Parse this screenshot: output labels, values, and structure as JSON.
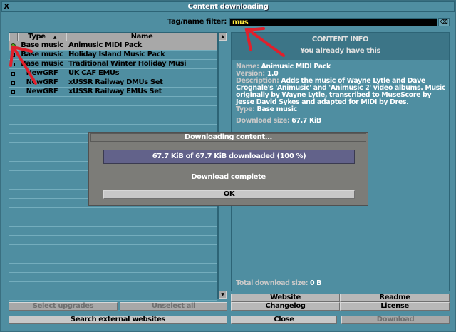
{
  "window": {
    "title": "Content downloading",
    "close_label": "X"
  },
  "filter": {
    "label": "Tag/name filter:",
    "value": "mus",
    "clear_label": "⌫"
  },
  "list": {
    "columns": {
      "type": "Type",
      "name": "Name",
      "sort_indicator": "▲"
    },
    "rows": [
      {
        "type": "Base music",
        "name": "Animusic MIDI Pack",
        "state": "installed",
        "selected": true
      },
      {
        "type": "Base music",
        "name": "Holiday Island Music Pack",
        "state": "not-installed"
      },
      {
        "type": "Base music",
        "name": "Traditional Winter Holiday Musi",
        "state": "not-installed"
      },
      {
        "type": "NewGRF",
        "name": "UK CAF EMUs",
        "state": "not-installed"
      },
      {
        "type": "NewGRF",
        "name": "xUSSR Railway DMUs Set",
        "state": "not-installed"
      },
      {
        "type": "NewGRF",
        "name": "xUSSR Railway EMUs Set",
        "state": "not-installed"
      }
    ]
  },
  "info": {
    "heading": "CONTENT INFO",
    "status": "You already have this",
    "name_key": "Name:",
    "name": "Animusic MIDI Pack",
    "version_key": "Version:",
    "version": "1.0",
    "description_key": "Description:",
    "description": "Adds the music of Wayne Lytle and Dave Crognale's 'Animusic' and 'Animusic 2' video albums. Music originally by Wayne Lytle, transcribed to MuseScore by Jesse David Sykes and adapted for MIDI by Dres.",
    "type_key": "Type:",
    "type": "Base music",
    "size_key": "Download size:",
    "size": "67.7 KiB",
    "total_key": "Total download size:",
    "total": "0 B"
  },
  "buttons": {
    "website": "Website",
    "readme": "Readme",
    "changelog": "Changelog",
    "license": "License",
    "select_upgrades": "Select upgrades",
    "unselect_all": "Unselect all",
    "search_external": "Search external websites",
    "close": "Close",
    "download": "Download"
  },
  "modal": {
    "title": "Downloading content...",
    "progress_text": "67.7 KiB of 67.7 KiB downloaded (100 %)",
    "progress_percent": 100,
    "status": "Download complete",
    "ok": "OK"
  },
  "colors": {
    "window": "#4f8ea1",
    "progress": "#62628a",
    "filter_text": "#ffea40",
    "annotation": "#e0202c"
  }
}
